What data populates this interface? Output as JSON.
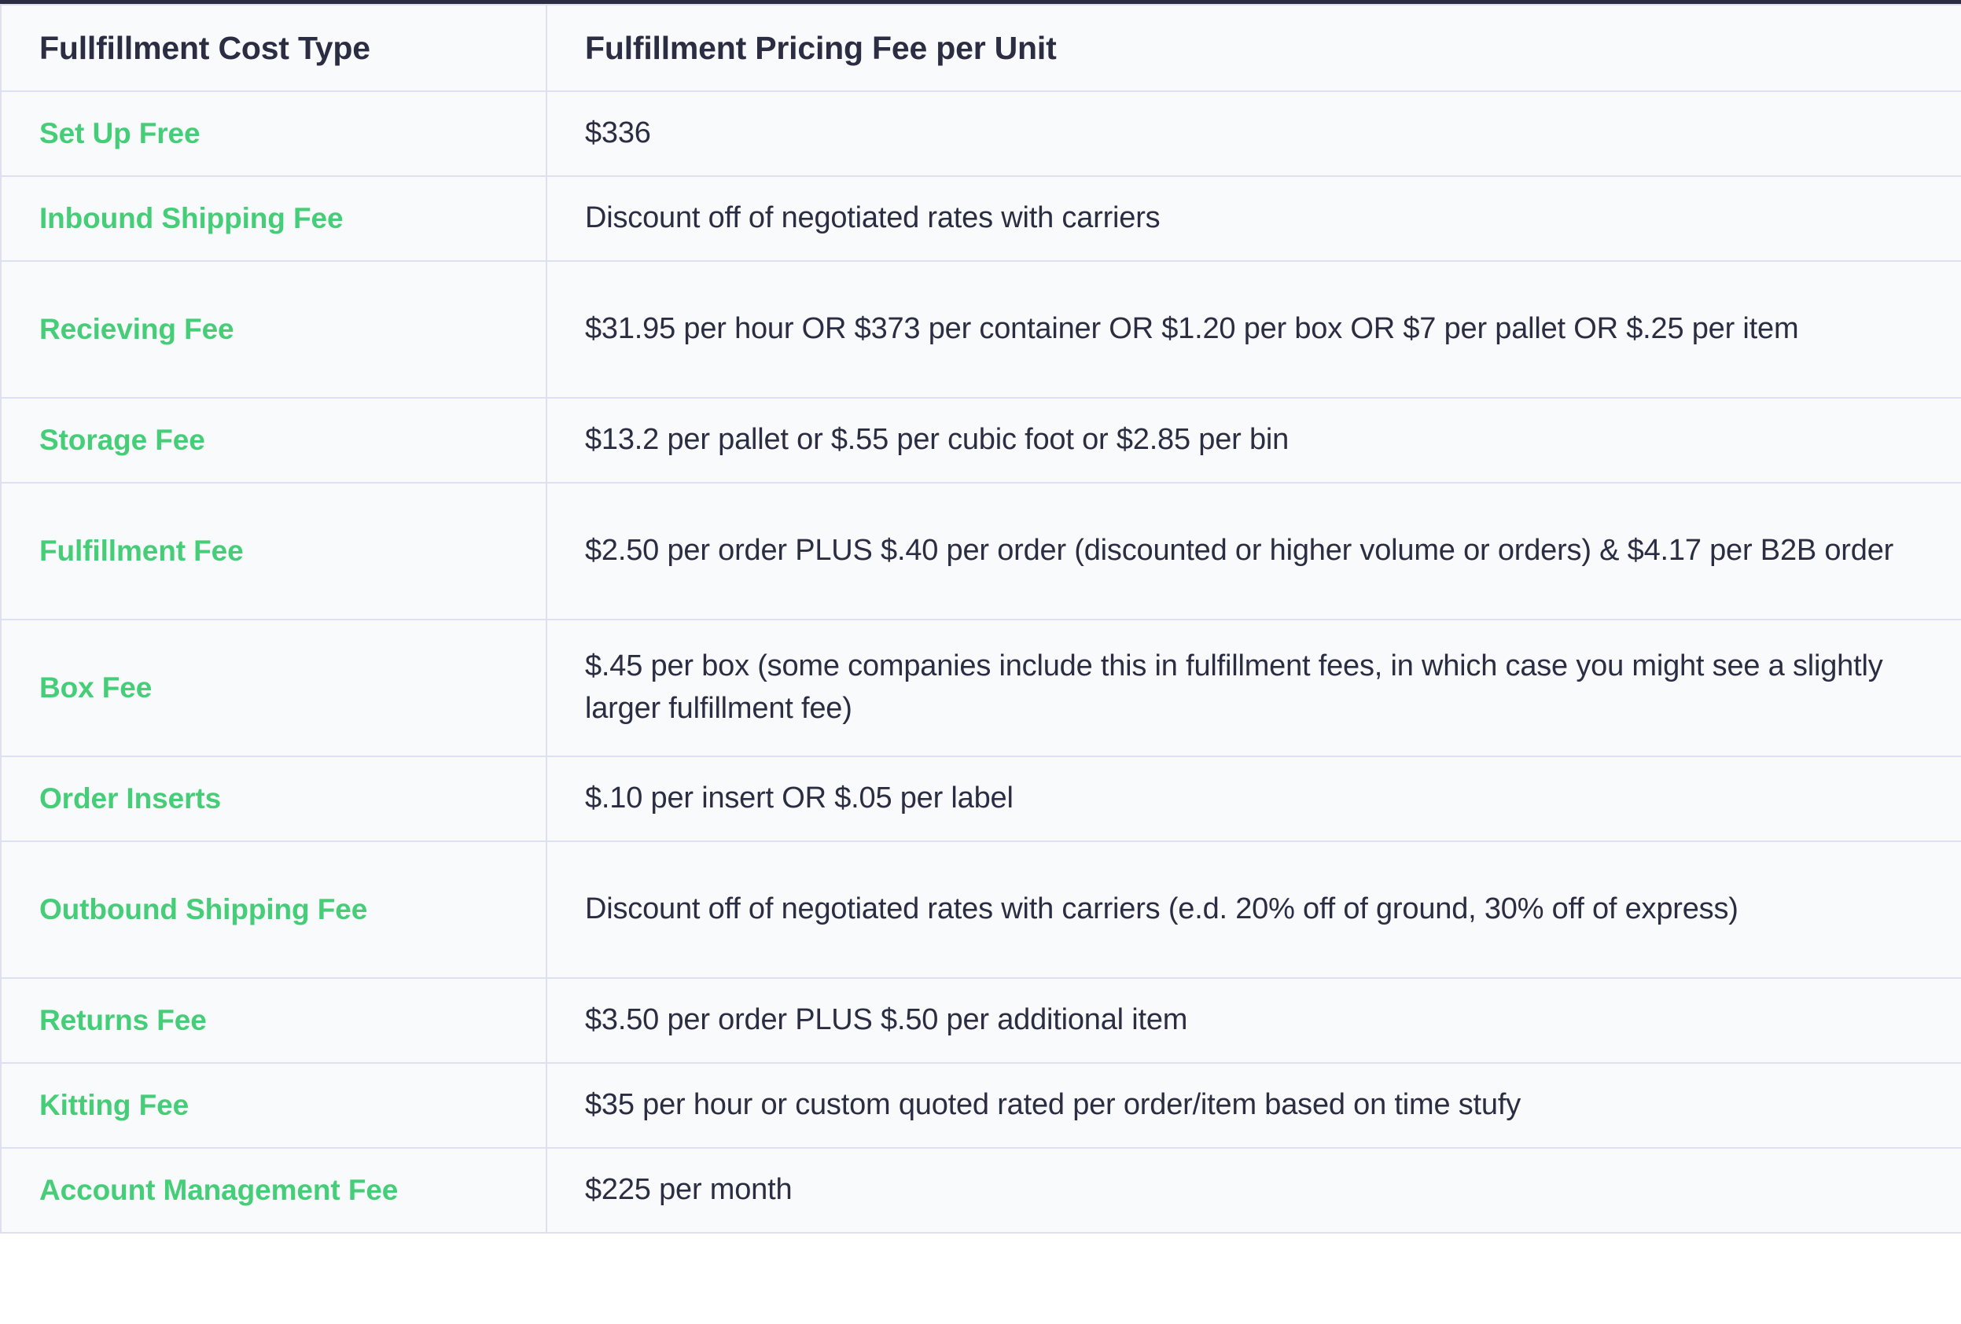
{
  "table": {
    "columns": [
      {
        "label": "Fullfillment Cost Type"
      },
      {
        "label": "Fulfillment Pricing Fee per Unit"
      }
    ],
    "accent_color": "#45ce77",
    "text_color": "#2b2d42",
    "border_color": "#dde0f0",
    "background_color": "#f9fafc",
    "rows": [
      {
        "cost_type": "Set Up Free",
        "fee": "$336"
      },
      {
        "cost_type": "Inbound Shipping Fee",
        "fee": "Discount off of negotiated rates with carriers"
      },
      {
        "cost_type": "Recieving Fee",
        "fee": "$31.95 per hour OR $373 per container OR $1.20 per box OR $7 per pallet OR $.25 per item"
      },
      {
        "cost_type": "Storage Fee",
        "fee": "$13.2 per pallet or $.55 per cubic foot or $2.85 per bin"
      },
      {
        "cost_type": "Fulfillment Fee",
        "fee": "$2.50 per order PLUS $.40 per order (discounted or higher volume or orders) & $4.17 per B2B order"
      },
      {
        "cost_type": "Box Fee",
        "fee": "$.45 per box (some companies include this in fulfillment fees, in which case you might see a slightly larger fulfillment fee)"
      },
      {
        "cost_type": "Order Inserts",
        "fee": "$.10 per insert OR $.05 per label"
      },
      {
        "cost_type": "Outbound Shipping Fee",
        "fee": "Discount off of negotiated rates with carriers (e.d. 20% off of ground, 30% off of express)"
      },
      {
        "cost_type": "Returns Fee",
        "fee": "$3.50 per order PLUS $.50 per additional item"
      },
      {
        "cost_type": "Kitting Fee",
        "fee": "$35 per hour or custom quoted rated per order/item based on time stufy"
      },
      {
        "cost_type": "Account Management Fee",
        "fee": "$225 per month"
      }
    ]
  }
}
